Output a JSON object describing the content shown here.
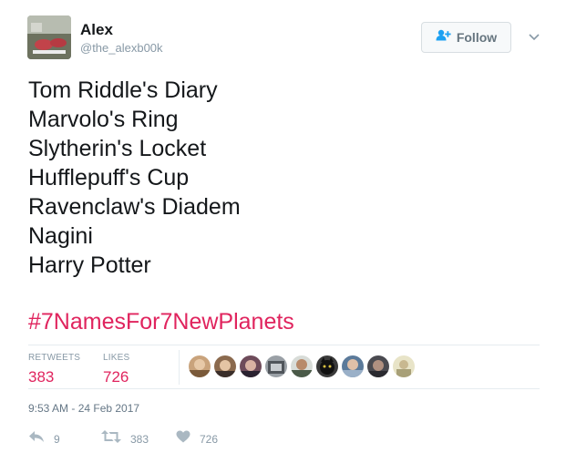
{
  "user": {
    "name": "Alex",
    "handle": "@the_alexb00k",
    "avatar_icon": "avatar-photo"
  },
  "header": {
    "follow_label": "Follow",
    "follow_icon": "add-user-icon",
    "menu_icon": "chevron-down-icon"
  },
  "tweet": {
    "lines": [
      "Tom Riddle's Diary",
      "Marvolo's Ring",
      "Slytherin's Locket",
      "Hufflepuff's Cup",
      "Ravenclaw's Diadem",
      "Nagini",
      "Harry Potter"
    ],
    "hashtag": "#7NamesFor7NewPlanets"
  },
  "stats": {
    "retweets_label": "RETWEETS",
    "retweets_value": "383",
    "likes_label": "LIKES",
    "likes_value": "726"
  },
  "likers": {
    "count_shown": 9
  },
  "timestamp": "9:53 AM - 24 Feb 2017",
  "actions": {
    "reply_count": "9",
    "retweet_count": "383",
    "like_count": "726"
  },
  "colors": {
    "accent": "#e0245e",
    "muted": "#8899a6",
    "text": "#14171a"
  }
}
